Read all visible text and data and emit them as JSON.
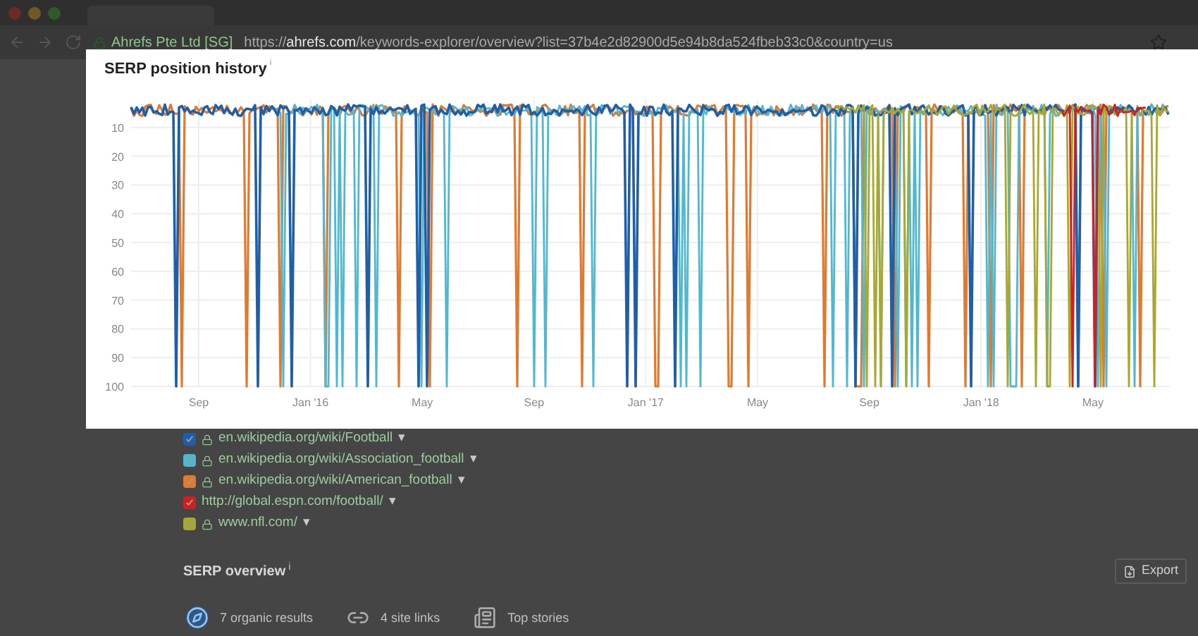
{
  "browser": {
    "site_owner": "Ahrefs Pte Ltd [SG]",
    "url_scheme": "https://",
    "url_domain": "ahrefs.com",
    "url_path": "/keywords-explorer/overview?list=37b4e2d82900d5e94b8da524fbeb33c0&country=us"
  },
  "modal": {
    "title": "SERP position history",
    "info": "i",
    "chart": {
      "yticks": [
        "10",
        "20",
        "30",
        "40",
        "50",
        "60",
        "70",
        "80",
        "90",
        "100"
      ],
      "xticks": [
        "Sep",
        "Jan '16",
        "May",
        "Sep",
        "Jan '17",
        "May",
        "Sep",
        "Jan '18",
        "May"
      ]
    }
  },
  "legend": {
    "items": [
      {
        "url": "en.wikipedia.org/wiki/Football",
        "caret": "▾",
        "secure": true,
        "checked": true,
        "color": "#1f5fa8"
      },
      {
        "url": "en.wikipedia.org/wiki/Association_football",
        "caret": "▾",
        "secure": true,
        "checked": true,
        "color": "#4fb8d0"
      },
      {
        "url": "en.wikipedia.org/wiki/American_football",
        "caret": "▾",
        "secure": true,
        "checked": true,
        "color": "#e07a30"
      },
      {
        "url": "http://global.espn.com/football/",
        "caret": "▾",
        "secure": false,
        "checked": true,
        "color": "#d02020"
      },
      {
        "url": "www.nfl.com/",
        "caret": "▾",
        "secure": true,
        "checked": true,
        "color": "#a8a830"
      }
    ]
  },
  "serp_overview": {
    "title": "SERP overview",
    "info": "i",
    "export": "Export",
    "stats": [
      {
        "kind": "organic",
        "label": "7 organic results"
      },
      {
        "kind": "links",
        "label": "4 site links"
      },
      {
        "kind": "stories",
        "label": "Top stories"
      }
    ]
  }
}
